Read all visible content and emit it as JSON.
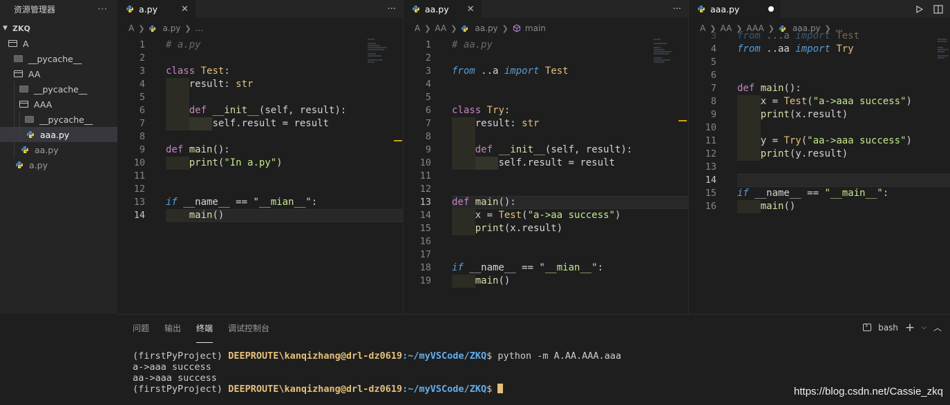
{
  "sidebar": {
    "title": "资源管理器",
    "more": "···",
    "root": "ZKQ",
    "items": [
      {
        "label": "A",
        "kind": "folder-open"
      },
      {
        "label": "__pycache__",
        "kind": "folder"
      },
      {
        "label": "AA",
        "kind": "folder-open"
      },
      {
        "label": "__pycache__",
        "kind": "folder"
      },
      {
        "label": "AAA",
        "kind": "folder-open"
      },
      {
        "label": "__pycache__",
        "kind": "folder"
      },
      {
        "label": "aaa.py",
        "kind": "python-file",
        "active": true
      },
      {
        "label": "aa.py",
        "kind": "python-file"
      },
      {
        "label": "a.py",
        "kind": "python-file"
      }
    ]
  },
  "editors": {
    "g1": {
      "tab": "a.py",
      "breadcrumb": [
        "A",
        "a.py",
        "..."
      ],
      "more": "···"
    },
    "g2": {
      "tab": "aa.py",
      "breadcrumb": [
        "A",
        "AA",
        "aa.py",
        "main"
      ],
      "more": "···"
    },
    "g3": {
      "tab": "aaa.py",
      "breadcrumb": [
        "A",
        "AA",
        "AAA",
        "aaa.py",
        "..."
      ]
    }
  },
  "panel": {
    "tabs": [
      "问题",
      "输出",
      "终端",
      "调试控制台"
    ],
    "active_tab": "终端",
    "shell": "bash",
    "terminal": {
      "env": "(firstPyProject)",
      "host": "DEEPROUTE\\kanqizhang@drl-dz0619",
      "path": ":~/myVSCode/ZKQ",
      "dollar": "$",
      "command": "python -m A.AA.AAA.aaa",
      "output1": "a->aaa success",
      "output2": "aa->aaa success"
    }
  },
  "watermark": "https://blog.csdn.net/Cassie_zkq",
  "colors": {
    "background": "#1e1e1e",
    "sidebar": "#252526",
    "keyword": "#c586c0",
    "class": "#e6c07b",
    "function": "#dcdcaa",
    "string": "#ce9178",
    "comment": "#6a6a6a"
  }
}
